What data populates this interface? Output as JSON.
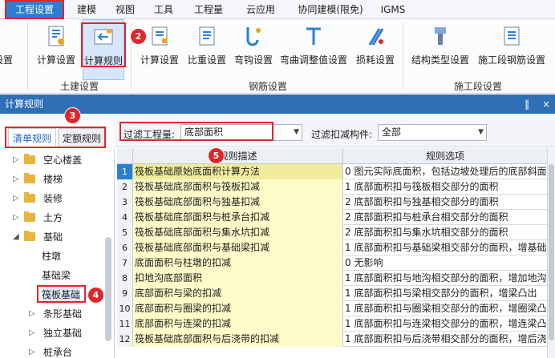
{
  "menu": {
    "items": [
      "工程设置",
      "建模",
      "视图",
      "工具",
      "工程量",
      "云应用",
      "协同建模(限免)",
      "IGMS"
    ]
  },
  "ribbon": {
    "left_partial": "设置",
    "tujian": {
      "group": "土建设置",
      "buttons": [
        "计算设置",
        "计算规则"
      ]
    },
    "gangjin": {
      "group": "钢筋设置",
      "buttons": [
        "计算设置",
        "比重设置",
        "弯钩设置",
        "弯曲调整值设置",
        "损耗设置"
      ]
    },
    "shigong": {
      "group": "施工段设置",
      "buttons": [
        "结构类型设置",
        "施工段钢筋设置"
      ]
    }
  },
  "dialog": {
    "title": "计算规则",
    "pin": "‖",
    "close": "×"
  },
  "tabs": [
    "清单规则",
    "定额规则"
  ],
  "filter": {
    "quantity_label": "过滤工程量:",
    "quantity_value": "底部面积",
    "component_label": "过滤扣减构件:",
    "component_value": "全部"
  },
  "tree": [
    {
      "label": "空心楼盖",
      "type": "folder"
    },
    {
      "label": "楼梯",
      "type": "folder"
    },
    {
      "label": "装修",
      "type": "folder"
    },
    {
      "label": "土方",
      "type": "folder"
    },
    {
      "label": "基础",
      "type": "folder-open"
    },
    {
      "label": "柱墩",
      "type": "leaf"
    },
    {
      "label": "基础梁",
      "type": "leaf"
    },
    {
      "label": "筏板基础",
      "type": "leaf-selected"
    },
    {
      "label": "条形基础",
      "type": "folder"
    },
    {
      "label": "独立基础",
      "type": "folder"
    },
    {
      "label": "桩承台",
      "type": "folder"
    }
  ],
  "table": {
    "headers": [
      "规则描述",
      "规则选项"
    ],
    "rows": [
      {
        "n": "1",
        "desc": "筏板基础原始底面积计算方法",
        "opt": "0 图元实际底面积，包括边坡处理后的底部斜面"
      },
      {
        "n": "2",
        "desc": "筏板基础底部面积与筏板扣减",
        "opt": "1 底部面积扣与筏板相交部分的面积"
      },
      {
        "n": "3",
        "desc": "筏板基础底部面积与独基扣减",
        "opt": "2 底部面积扣与独基相交部分的面积"
      },
      {
        "n": "4",
        "desc": "筏板基础底部面积与桩承台扣减",
        "opt": "2 底部面积扣与桩承台相交部分的面积"
      },
      {
        "n": "5",
        "desc": "筏板基础底部面积与集水坑扣减",
        "opt": "2 底部面积扣与集水坑相交部分的面积"
      },
      {
        "n": "6",
        "desc": "筏板基础底部面积与基础梁扣减",
        "opt": "1 底部面积扣与基础梁相交部分的面积，增基础"
      },
      {
        "n": "7",
        "desc": "底面面积与柱墩的扣减",
        "opt": "0  无影响"
      },
      {
        "n": "8",
        "desc": "扣地沟底部面积",
        "opt": "1 底部面积扣与地沟相交部分的面积，增加地沟"
      },
      {
        "n": "9",
        "desc": "底部面积与梁的扣减",
        "opt": "1 底部面积扣与梁相交部分的面积，增梁凸出"
      },
      {
        "n": "10",
        "desc": "底部面积与圈梁的扣减",
        "opt": "1 底部面积扣与圈梁相交部分的面积，增圈梁凸"
      },
      {
        "n": "11",
        "desc": "底部面积与连梁的扣减",
        "opt": "1 底部面积扣与连梁相交部分的面积，增连梁凸"
      },
      {
        "n": "12",
        "desc": "筏板基础底部面积与后浇带的扣减",
        "opt": "1 底部面积扣与后浇带相交部分的面积，增后浇"
      }
    ]
  },
  "annotations": [
    "1",
    "2",
    "3",
    "4",
    "5"
  ],
  "colors": {
    "accent": "#2b7fd3",
    "highlight_red": "#e0262b",
    "yellow_cell": "#fdfbc8"
  }
}
